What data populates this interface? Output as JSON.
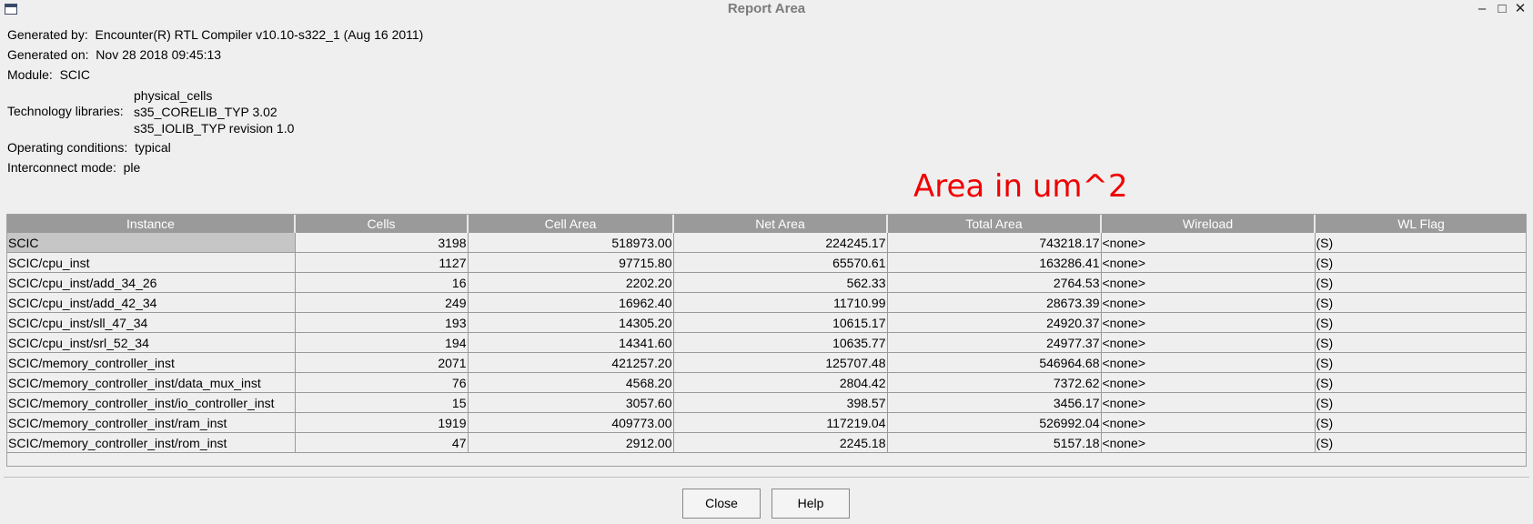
{
  "window": {
    "title": "Report Area"
  },
  "info": {
    "generated_by_label": "Generated by:",
    "generated_by": "Encounter(R) RTL Compiler v10.10-s322_1 (Aug 16 2011)",
    "generated_on_label": "Generated on:",
    "generated_on": "Nov 28 2018 09:45:13",
    "module_label": "Module:",
    "module": "SCIC",
    "tech_libs_label": "Technology libraries:",
    "tech_libs": [
      "physical_cells",
      "s35_CORELIB_TYP 3.02",
      "s35_IOLIB_TYP revision 1.0"
    ],
    "operating_conditions_label": "Operating conditions:",
    "operating_conditions": "typical",
    "interconnect_mode_label": "Interconnect mode:",
    "interconnect_mode": "ple"
  },
  "annotation": "Area in um^2",
  "table": {
    "columns": [
      "Instance",
      "Cells",
      "Cell Area",
      "Net Area",
      "Total Area",
      "Wireload",
      "WL Flag"
    ],
    "rows": [
      [
        "SCIC",
        "3198",
        "518973.00",
        "224245.17",
        "743218.17",
        "<none>",
        "(S)"
      ],
      [
        "SCIC/cpu_inst",
        "1127",
        "97715.80",
        "65570.61",
        "163286.41",
        "<none>",
        "(S)"
      ],
      [
        "SCIC/cpu_inst/add_34_26",
        "16",
        "2202.20",
        "562.33",
        "2764.53",
        "<none>",
        "(S)"
      ],
      [
        "SCIC/cpu_inst/add_42_34",
        "249",
        "16962.40",
        "11710.99",
        "28673.39",
        "<none>",
        "(S)"
      ],
      [
        "SCIC/cpu_inst/sll_47_34",
        "193",
        "14305.20",
        "10615.17",
        "24920.37",
        "<none>",
        "(S)"
      ],
      [
        "SCIC/cpu_inst/srl_52_34",
        "194",
        "14341.60",
        "10635.77",
        "24977.37",
        "<none>",
        "(S)"
      ],
      [
        "SCIC/memory_controller_inst",
        "2071",
        "421257.20",
        "125707.48",
        "546964.68",
        "<none>",
        "(S)"
      ],
      [
        "SCIC/memory_controller_inst/data_mux_inst",
        "76",
        "4568.20",
        "2804.42",
        "7372.62",
        "<none>",
        "(S)"
      ],
      [
        "SCIC/memory_controller_inst/io_controller_inst",
        "15",
        "3057.60",
        "398.57",
        "3456.17",
        "<none>",
        "(S)"
      ],
      [
        "SCIC/memory_controller_inst/ram_inst",
        "1919",
        "409773.00",
        "117219.04",
        "526992.04",
        "<none>",
        "(S)"
      ],
      [
        "SCIC/memory_controller_inst/rom_inst",
        "47",
        "2912.00",
        "2245.18",
        "5157.18",
        "<none>",
        "(S)"
      ]
    ],
    "selected_row": 0
  },
  "buttons": {
    "close": "Close",
    "help": "Help"
  },
  "icons": {
    "minimize": "minimize-icon",
    "maximize": "maximize-icon",
    "close": "close-icon",
    "app": "window-app-icon"
  },
  "colors": {
    "header_bg": "#9a9a9a",
    "annotation": "#f00000",
    "window_bg": "#efefef",
    "selection": "#c6c6c6"
  }
}
